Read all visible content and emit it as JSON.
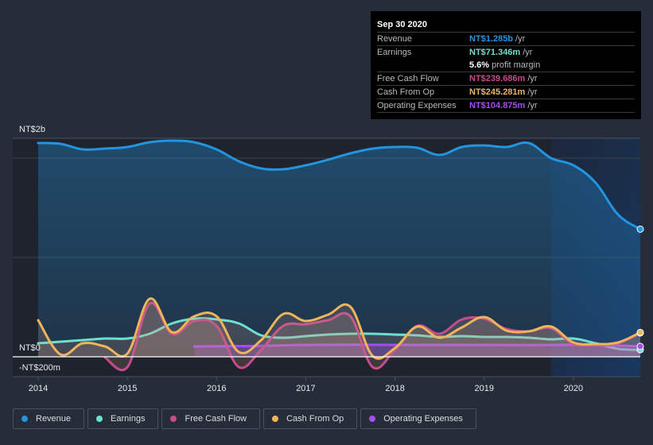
{
  "tooltip": {
    "date": "Sep 30 2020",
    "rows": [
      {
        "label": "Revenue",
        "value": "NT$1.285b",
        "unit": "/yr",
        "color": "#2394df"
      },
      {
        "label": "Earnings",
        "value": "NT$71.346m",
        "unit": "/yr",
        "color": "#6ce0d0"
      },
      {
        "label": "",
        "value": "5.6%",
        "unit": "profit margin",
        "color": "#ffffff"
      },
      {
        "label": "Free Cash Flow",
        "value": "NT$239.686m",
        "unit": "/yr",
        "color": "#c84b8c"
      },
      {
        "label": "Cash From Op",
        "value": "NT$245.281m",
        "unit": "/yr",
        "color": "#f0b45a"
      },
      {
        "label": "Operating Expenses",
        "value": "NT$104.875m",
        "unit": "/yr",
        "color": "#a64cf0"
      }
    ]
  },
  "legend": [
    {
      "label": "Revenue",
      "color": "#2394df"
    },
    {
      "label": "Earnings",
      "color": "#6ce0d0"
    },
    {
      "label": "Free Cash Flow",
      "color": "#c84b8c"
    },
    {
      "label": "Cash From Op",
      "color": "#f0b45a"
    },
    {
      "label": "Operating Expenses",
      "color": "#a64cf0"
    }
  ],
  "chart_data": {
    "type": "area",
    "title": "",
    "xlabel": "",
    "ylabel": "",
    "unit": "NT$ millions",
    "y_tick_labels": [
      {
        "label": "NT$2b",
        "value": 2000
      },
      {
        "label": "NT$0",
        "value": 0
      },
      {
        "label": "-NT$200m",
        "value": -200
      }
    ],
    "x_tick_labels": [
      "2014",
      "2015",
      "2016",
      "2017",
      "2018",
      "2019",
      "2020"
    ],
    "xlim": [
      2014.0,
      2020.75
    ],
    "ylim": [
      -200,
      2200
    ],
    "grid": true,
    "legend_position": "bottom",
    "highlight_region": [
      2019.75,
      2020.75
    ],
    "series": [
      {
        "name": "Revenue",
        "color": "#2394df",
        "x": [
          2014.0,
          2014.25,
          2014.5,
          2014.75,
          2015.0,
          2015.25,
          2015.5,
          2015.75,
          2016.0,
          2016.25,
          2016.5,
          2016.75,
          2017.0,
          2017.25,
          2017.5,
          2017.75,
          2018.0,
          2018.25,
          2018.5,
          2018.75,
          2019.0,
          2019.25,
          2019.5,
          2019.75,
          2020.0,
          2020.25,
          2020.5,
          2020.75
        ],
        "values": [
          2152,
          2144,
          2088,
          2096,
          2112,
          2160,
          2176,
          2160,
          2088,
          1968,
          1896,
          1888,
          1928,
          1984,
          2048,
          2096,
          2112,
          2104,
          2032,
          2112,
          2128,
          2112,
          2152,
          2000,
          1928,
          1752,
          1432,
          1285
        ]
      },
      {
        "name": "Earnings",
        "color": "#6ce0d0",
        "x": [
          2014.0,
          2014.25,
          2014.5,
          2014.75,
          2015.0,
          2015.25,
          2015.5,
          2015.75,
          2016.0,
          2016.25,
          2016.5,
          2016.75,
          2017.0,
          2017.25,
          2017.5,
          2017.75,
          2018.0,
          2018.25,
          2018.5,
          2018.75,
          2019.0,
          2019.25,
          2019.5,
          2019.75,
          2020.0,
          2020.25,
          2020.5,
          2020.75
        ],
        "values": [
          136,
          152,
          168,
          184,
          184,
          232,
          336,
          384,
          376,
          336,
          216,
          192,
          208,
          224,
          232,
          232,
          224,
          216,
          200,
          208,
          200,
          200,
          192,
          176,
          184,
          136,
          80,
          71
        ]
      },
      {
        "name": "Free Cash Flow",
        "color": "#c84b8c",
        "x": [
          2014.75,
          2015.0,
          2015.25,
          2015.5,
          2015.75,
          2016.0,
          2016.25,
          2016.5,
          2016.75,
          2017.0,
          2017.25,
          2017.5,
          2017.75,
          2018.0,
          2018.25,
          2018.5,
          2018.75,
          2019.0,
          2019.25,
          2019.5,
          2019.75,
          2020.0,
          2020.25,
          2020.5,
          2020.75
        ],
        "values": [
          -8,
          -104,
          536,
          232,
          360,
          312,
          -104,
          72,
          312,
          328,
          368,
          408,
          -104,
          72,
          312,
          232,
          376,
          384,
          280,
          256,
          288,
          128,
          120,
          136,
          240
        ]
      },
      {
        "name": "Cash From Op",
        "color": "#f0b45a",
        "x": [
          2014.0,
          2014.25,
          2014.5,
          2014.75,
          2015.0,
          2015.25,
          2015.5,
          2015.75,
          2016.0,
          2016.25,
          2016.5,
          2016.75,
          2017.0,
          2017.25,
          2017.5,
          2017.75,
          2018.0,
          2018.25,
          2018.5,
          2018.75,
          2019.0,
          2019.25,
          2019.5,
          2019.75,
          2020.0,
          2020.25,
          2020.5,
          2020.75
        ],
        "values": [
          368,
          24,
          136,
          104,
          32,
          584,
          248,
          408,
          408,
          48,
          168,
          432,
          360,
          424,
          504,
          8,
          88,
          304,
          192,
          296,
          400,
          264,
          256,
          304,
          144,
          128,
          144,
          245
        ]
      },
      {
        "name": "Operating Expenses",
        "color": "#a64cf0",
        "x": [
          2015.75,
          2016.0,
          2016.5,
          2017.0,
          2017.5,
          2018.0,
          2018.5,
          2019.0,
          2019.5,
          2020.0,
          2020.5,
          2020.75
        ],
        "values": [
          104,
          106,
          110,
          120,
          122,
          120,
          120,
          120,
          118,
          120,
          112,
          105
        ]
      }
    ]
  }
}
